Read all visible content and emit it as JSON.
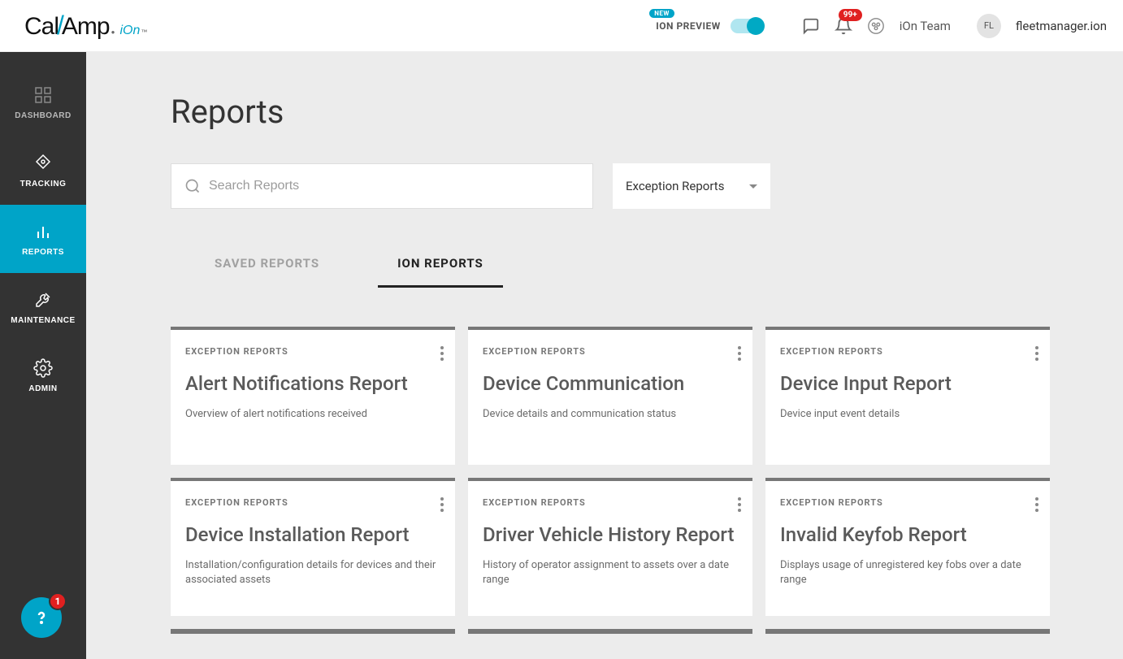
{
  "header": {
    "logo_part1": "Cal",
    "logo_part2": "Amp",
    "logo_ion": "iOn",
    "new_badge": "NEW",
    "ion_preview": "ION PREVIEW",
    "toggle_on": true,
    "notification_badge": "99+",
    "team_label": "iOn Team",
    "avatar_initials": "FL",
    "username": "fleetmanager.ion"
  },
  "sidebar": {
    "items": [
      {
        "id": "dashboard",
        "label": "DASHBOARD",
        "active": false
      },
      {
        "id": "tracking",
        "label": "TRACKING",
        "active": false
      },
      {
        "id": "reports",
        "label": "REPORTS",
        "active": true
      },
      {
        "id": "maintenance",
        "label": "MAINTENANCE",
        "active": false
      },
      {
        "id": "admin",
        "label": "ADMIN",
        "active": false
      }
    ]
  },
  "main": {
    "title": "Reports",
    "search_placeholder": "Search Reports",
    "dropdown_selected": "Exception Reports",
    "tabs": [
      {
        "label": "SAVED REPORTS",
        "active": false
      },
      {
        "label": "ION REPORTS",
        "active": true
      }
    ],
    "cards": [
      {
        "category": "EXCEPTION REPORTS",
        "title": "Alert Notifications Report",
        "desc": "Overview of alert notifications received"
      },
      {
        "category": "EXCEPTION REPORTS",
        "title": "Device Communication",
        "desc": "Device details and communication status"
      },
      {
        "category": "EXCEPTION REPORTS",
        "title": "Device Input Report",
        "desc": "Device input event details"
      },
      {
        "category": "EXCEPTION REPORTS",
        "title": "Device Installation Report",
        "desc": "Installation/configuration details for devices and their associated assets"
      },
      {
        "category": "EXCEPTION REPORTS",
        "title": "Driver Vehicle History Report",
        "desc": "History of operator assignment to assets over a date range"
      },
      {
        "category": "EXCEPTION REPORTS",
        "title": "Invalid Keyfob Report",
        "desc": "Displays usage of unregistered key fobs over a date range"
      }
    ]
  },
  "help_fab_badge": "1"
}
